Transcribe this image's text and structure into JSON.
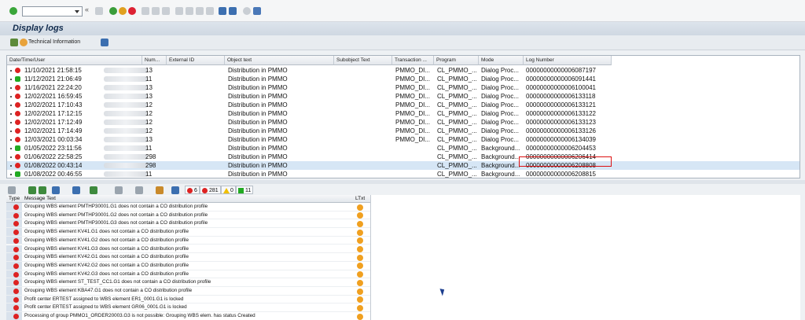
{
  "page": {
    "title": "Display logs"
  },
  "toolbar": {
    "tech_info_label": "Technical Information"
  },
  "grid": {
    "headers": [
      "Date/Time/User",
      "Num...",
      "External ID",
      "Object text",
      "Subobject Text",
      "Transaction ...",
      "Program",
      "Mode",
      "Log Number"
    ],
    "rows": [
      {
        "status": "red",
        "date": "11/10/2021",
        "time": "21:58:15",
        "num": "13",
        "object": "Distribution in PMMO",
        "trans": "PMMO_DI...",
        "program": "CL_PMMO_...",
        "mode": "Dialog Proc...",
        "log": "00000000000006087197"
      },
      {
        "status": "green",
        "date": "11/12/2021",
        "time": "21:06:49",
        "num": "11",
        "object": "Distribution in PMMO",
        "trans": "PMMO_DI...",
        "program": "CL_PMMO_...",
        "mode": "Dialog Proc...",
        "log": "00000000000006091441"
      },
      {
        "status": "red",
        "date": "11/16/2021",
        "time": "22:24:20",
        "num": "13",
        "object": "Distribution in PMMO",
        "trans": "PMMO_DI...",
        "program": "CL_PMMO_...",
        "mode": "Dialog Proc...",
        "log": "00000000000006100041"
      },
      {
        "status": "red",
        "date": "12/02/2021",
        "time": "16:59:45",
        "num": "13",
        "object": "Distribution in PMMO",
        "trans": "PMMO_DI...",
        "program": "CL_PMMO_...",
        "mode": "Dialog Proc...",
        "log": "00000000000006133118"
      },
      {
        "status": "red",
        "date": "12/02/2021",
        "time": "17:10:43",
        "num": "12",
        "object": "Distribution in PMMO",
        "trans": "PMMO_DI...",
        "program": "CL_PMMO_...",
        "mode": "Dialog Proc...",
        "log": "00000000000006133121"
      },
      {
        "status": "red",
        "date": "12/02/2021",
        "time": "17:12:15",
        "num": "12",
        "object": "Distribution in PMMO",
        "trans": "PMMO_DI...",
        "program": "CL_PMMO_...",
        "mode": "Dialog Proc...",
        "log": "00000000000006133122"
      },
      {
        "status": "red",
        "date": "12/02/2021",
        "time": "17:12:49",
        "num": "12",
        "object": "Distribution in PMMO",
        "trans": "PMMO_DI...",
        "program": "CL_PMMO_...",
        "mode": "Dialog Proc...",
        "log": "00000000000006133123"
      },
      {
        "status": "red",
        "date": "12/02/2021",
        "time": "17:14:49",
        "num": "12",
        "object": "Distribution in PMMO",
        "trans": "PMMO_DI...",
        "program": "CL_PMMO_...",
        "mode": "Dialog Proc...",
        "log": "00000000000006133126"
      },
      {
        "status": "red",
        "date": "12/03/2021",
        "time": "00:03:34",
        "num": "13",
        "object": "Distribution in PMMO",
        "trans": "PMMO_DI...",
        "program": "CL_PMMO_...",
        "mode": "Dialog Proc...",
        "log": "00000000000006134039"
      },
      {
        "status": "green",
        "date": "01/05/2022",
        "time": "23:11:56",
        "num": "11",
        "object": "Distribution in PMMO",
        "trans": "",
        "program": "CL_PMMO_...",
        "mode": "Background...",
        "log": "00000000000006204453"
      },
      {
        "status": "red",
        "date": "01/06/2022",
        "time": "22:58:25",
        "num": "298",
        "object": "Distribution in PMMO",
        "trans": "",
        "program": "CL_PMMO_...",
        "mode": "Background...",
        "log": "00000000000006206414"
      },
      {
        "status": "red",
        "date": "01/08/2022",
        "time": "00:43:14",
        "num": "298",
        "object": "Distribution in PMMO",
        "trans": "",
        "program": "CL_PMMO_...",
        "mode": "Background...",
        "log": "00000000000006208808"
      },
      {
        "status": "green",
        "date": "01/08/2022",
        "time": "00:46:55",
        "num": "11",
        "object": "Distribution in PMMO",
        "trans": "",
        "program": "CL_PMMO_...",
        "mode": "Background...",
        "log": "00000000000006208815"
      }
    ]
  },
  "counts": {
    "red_stop": "6",
    "error": "281",
    "warning": "0",
    "success": "11"
  },
  "messages": {
    "headers": [
      "Type",
      "Message Text",
      "LTxt"
    ],
    "rows": [
      "Grouping WBS element PMTHP30001.G1 does not contain a CO distribution profile",
      "Grouping WBS element PMTHP30001.G2 does not contain a CO distribution profile",
      "Grouping WBS element PMTHP30001.G3 does not contain a CO distribution profile",
      "Grouping WBS element KV41.G1 does not contain a CO distribution profile",
      "Grouping WBS element KV41.G2 does not contain a CO distribution profile",
      "Grouping WBS element KV41.G3 does not contain a CO distribution profile",
      "Grouping WBS element KV42.G1 does not contain a CO distribution profile",
      "Grouping WBS element KV42.G2 does not contain a CO distribution profile",
      "Grouping WBS element KV42.G3 does not contain a CO distribution profile",
      "Grouping WBS element ST_TEST_CC1.G1 does not contain a CO distribution profile",
      "Grouping WBS element KBA47.G1 does not contain a CO distribution profile",
      "Profit center ERTEST assigned to WBS element ER1_0001.G1 is locked",
      "Profit center ERTEST assigned to WBS element GR06_0001.G1 is locked",
      "Processing of group PMMO1_ORDER20003.G3 is not possible: Grouping WBS elem. has status Created",
      "Processing of group PMMO1_ORDER20003.G2 is not possible: Grouping WBS elem. has status Created"
    ]
  }
}
